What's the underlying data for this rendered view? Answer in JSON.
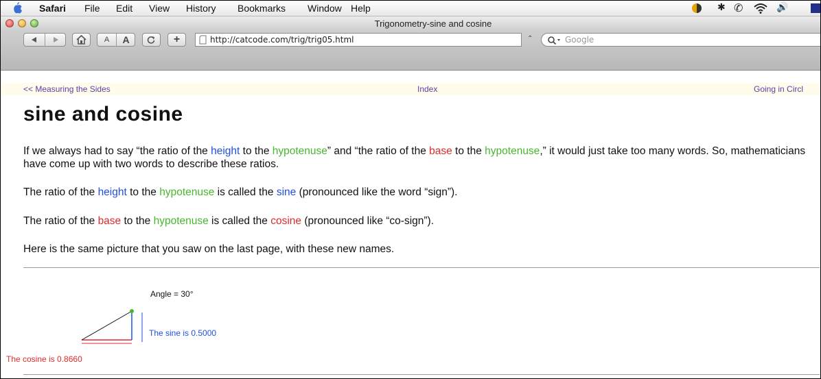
{
  "menubar": {
    "app_name": "Safari",
    "items": [
      "File",
      "Edit",
      "View",
      "History",
      "Bookmarks",
      "Window",
      "Help"
    ]
  },
  "window": {
    "title": "Trigonometry-sine and cosine"
  },
  "toolbar": {
    "text_smaller": "A",
    "text_bigger": "A",
    "add_bookmark": "+",
    "url": "http://catcode.com/trig/trig05.html",
    "search_placeholder": "Google"
  },
  "page": {
    "nav": {
      "prev": "<< Measuring the Sides",
      "index": "Index",
      "next": "Going in Circl"
    },
    "heading": "sine and cosine",
    "para1": {
      "t1": "If we always had to say “the ratio of the ",
      "height": "height",
      "t2": " to the ",
      "hyp1": "hypotenuse",
      "t3": "” and “the ratio of the ",
      "base": "base",
      "t4": " to the ",
      "hyp2": "hypotenuse",
      "t5": ",” it would just take too many words. So, mathematicians have come up with two words to describe these ratios."
    },
    "para2": {
      "t1": "The ratio of the ",
      "height": "height",
      "t2": " to the ",
      "hyp": "hypotenuse",
      "t3": " is called the ",
      "sine": "sine",
      "t4": " (pronounced like the word “sign”)."
    },
    "para3": {
      "t1": "The ratio of the ",
      "base": "base",
      "t2": " to the ",
      "hyp": "hypotenuse",
      "t3": " is called the ",
      "cosine": "cosine",
      "t4": " (pronounced like “co-sign”)."
    },
    "para4": "Here is the same picture that you saw on the last page, with these new names.",
    "applet": {
      "angle_label": "Angle = 30°",
      "sine_label": "The sine is 0.5000",
      "cosine_label": "The cosine is 0.8660"
    }
  },
  "colors": {
    "height_sine": "#1f4fe0",
    "hypotenuse": "#46b82e",
    "base_cosine": "#e02a2a",
    "nav_link": "#5a3fa8"
  }
}
